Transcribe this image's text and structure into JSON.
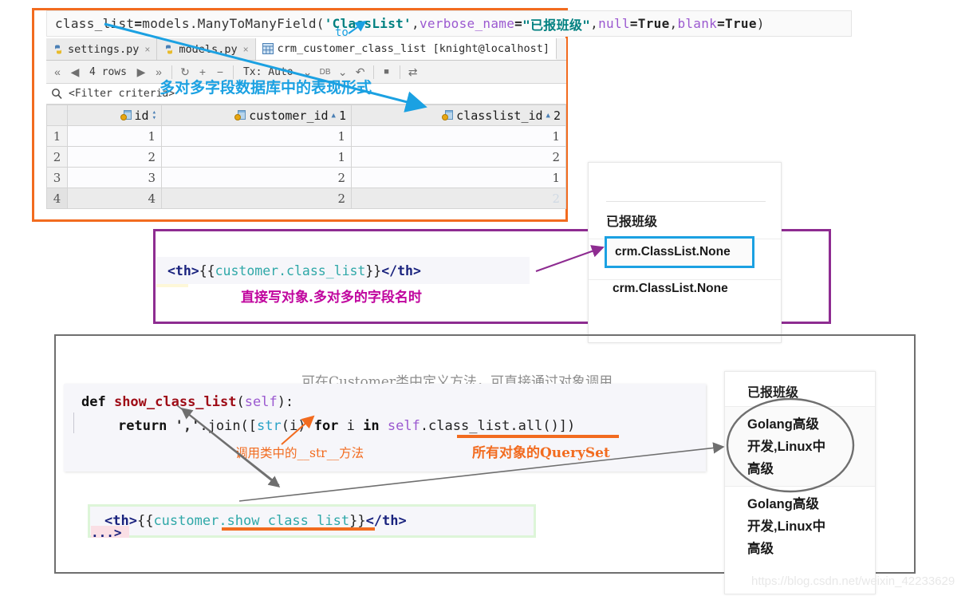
{
  "top_code": {
    "segments": [
      {
        "t": "class_list ",
        "c": "plain"
      },
      {
        "t": "= ",
        "c": "bold"
      },
      {
        "t": "models.ManyToManyField(",
        "c": "plain"
      },
      {
        "t": "'ClassList'",
        "c": "str"
      },
      {
        "t": ", ",
        "c": "plain"
      },
      {
        "t": "verbose_name",
        "c": "kwarg"
      },
      {
        "t": "=",
        "c": "bold"
      },
      {
        "t": "\"已报班级\"",
        "c": "quote"
      },
      {
        "t": ", ",
        "c": "plain"
      },
      {
        "t": "null",
        "c": "kwarg"
      },
      {
        "t": "=",
        "c": "bold"
      },
      {
        "t": "True",
        "c": "bold"
      },
      {
        "t": ", ",
        "c": "plain"
      },
      {
        "t": "blank",
        "c": "kwarg"
      },
      {
        "t": "=",
        "c": "bold"
      },
      {
        "t": "True",
        "c": "bold"
      },
      {
        "t": ")",
        "c": "plain"
      }
    ],
    "to_label": "to"
  },
  "ide": {
    "tabs": [
      {
        "label": "settings.py",
        "icon": "python-file-icon",
        "active": false,
        "close": "×"
      },
      {
        "label": "models.py",
        "icon": "python-file-icon",
        "active": false,
        "close": "×"
      },
      {
        "label": "crm_customer_class_list [knight@localhost]",
        "icon": "table-icon",
        "active": true,
        "close": ""
      }
    ],
    "toolbar": {
      "first_icon": "«",
      "prev_icon": "◀",
      "rows_label": "4 rows",
      "next_icon": "▶",
      "last_icon": "»",
      "refresh_icon": "↻",
      "add_icon": "+",
      "remove_icon": "−",
      "tx_label": "Tx: Auto",
      "tx_chevron": "⌄",
      "db_label": "DB",
      "db_chevron": "⌄",
      "rollback_icon": "↶",
      "stop_icon": "■",
      "export_icon": "⇄"
    },
    "filter": {
      "icon": "magnifier-icon",
      "placeholder": "<Filter criteria>"
    },
    "grid": {
      "columns": [
        {
          "name": "id",
          "sort": "updown",
          "order": ""
        },
        {
          "name": "customer_id",
          "sort": "asc",
          "order": "1"
        },
        {
          "name": "classlist_id",
          "sort": "asc",
          "order": "2"
        }
      ],
      "rows": [
        {
          "n": "1",
          "id": "1",
          "customer_id": "1",
          "classlist_id": "1"
        },
        {
          "n": "2",
          "id": "2",
          "customer_id": "1",
          "classlist_id": "2"
        },
        {
          "n": "3",
          "id": "3",
          "customer_id": "2",
          "classlist_id": "1"
        },
        {
          "n": "4",
          "id": "4",
          "customer_id": "2",
          "classlist_id": "2"
        }
      ],
      "selected_row": 4,
      "selected_col": "classlist_id"
    }
  },
  "annotations": {
    "blue_note": "多对多字段数据库中的表现形式",
    "purple_note": "直接写对象.多对多的字段名时",
    "gray_note": "可在Customer类中定义方法，可直接通过对象调用",
    "orange_note_queryset": "所有对象的QuerySet",
    "orange_note_str": "调用类中的__str__方法"
  },
  "purple_code": {
    "segments": [
      {
        "t": "<th>",
        "c": "tag"
      },
      {
        "t": "{{ ",
        "c": "brace"
      },
      {
        "t": "customer.class_list",
        "c": "var"
      },
      {
        "t": " }}",
        "c": "brace"
      },
      {
        "t": "</th>",
        "c": "tag"
      }
    ]
  },
  "panel_none": {
    "header": "已报班级",
    "row1": "crm.ClassList.None",
    "row2": "crm.ClassList.None"
  },
  "py_code": {
    "line1": [
      {
        "t": "def ",
        "c": "kw"
      },
      {
        "t": "show_class_list",
        "c": "fn"
      },
      {
        "t": "(",
        "c": "plain"
      },
      {
        "t": "self",
        "c": "self"
      },
      {
        "t": "):",
        "c": "plain"
      }
    ],
    "line2": [
      {
        "t": "return ",
        "c": "kw"
      },
      {
        "t": "','",
        "c": "str"
      },
      {
        "t": ".join([",
        "c": "plain"
      },
      {
        "t": "str",
        "c": "bi"
      },
      {
        "t": "(i) ",
        "c": "plain"
      },
      {
        "t": "for ",
        "c": "kw"
      },
      {
        "t": "i ",
        "c": "plain"
      },
      {
        "t": "in ",
        "c": "kw"
      },
      {
        "t": "self",
        "c": "self"
      },
      {
        "t": ".class_list.all()])",
        "c": "plain"
      }
    ]
  },
  "green_code": {
    "segments": [
      {
        "t": "<th>",
        "c": "tag"
      },
      {
        "t": "{{ ",
        "c": "brace"
      },
      {
        "t": "customer.show_class_list",
        "c": "var"
      },
      {
        "t": " }}",
        "c": "brace"
      },
      {
        "t": "</th>",
        "c": "tag"
      }
    ],
    "next_line": "...>"
  },
  "panel_golang": {
    "header": "已报班级",
    "row1": "Golang高级开发,Linux中高级",
    "row1_lines": [
      "Golang高级",
      "开发,Linux中",
      "高级"
    ],
    "row2_lines": [
      "Golang高级",
      "开发,Linux中",
      "高级"
    ]
  },
  "watermark": "https://blog.csdn.net/weixin_42233629",
  "colors": {
    "orange_box": "#F26B1F",
    "purple_box": "#8E2C91",
    "gray_box": "#6F6F6F",
    "blue_accent": "#1BA1E2",
    "green_box": "#DDF5D8",
    "magenta_text": "#C0059E"
  }
}
